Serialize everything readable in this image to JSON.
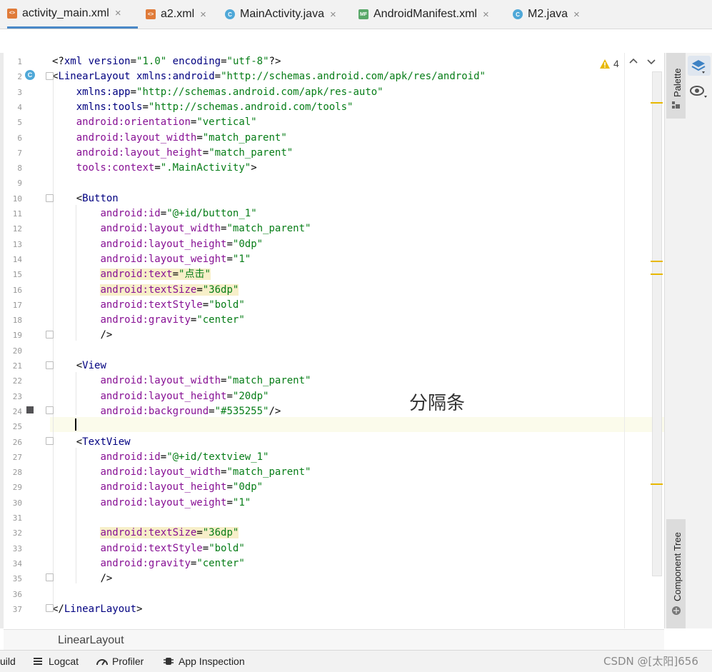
{
  "tabs": [
    {
      "label": "activity_main.xml",
      "icon": "xml-file-icon",
      "active": true
    },
    {
      "label": "a2.xml",
      "icon": "xml-file-icon",
      "active": false
    },
    {
      "label": "MainActivity.java",
      "icon": "java-class-icon",
      "active": false
    },
    {
      "label": "AndroidManifest.xml",
      "icon": "manifest-file-icon",
      "active": false
    },
    {
      "label": "M2.java",
      "icon": "java-class-icon",
      "active": false
    }
  ],
  "tab_close_glyph": "×",
  "icon_glyphs": {
    "xml": "<>",
    "java": "C",
    "mf": "MF"
  },
  "warnings": {
    "count": "4",
    "icon": "warning-icon"
  },
  "line_numbers": [
    "1",
    "2",
    "3",
    "4",
    "5",
    "6",
    "7",
    "8",
    "9",
    "10",
    "11",
    "12",
    "13",
    "14",
    "15",
    "16",
    "17",
    "18",
    "19",
    "20",
    "21",
    "22",
    "23",
    "24",
    "25",
    "26",
    "27",
    "28",
    "29",
    "30",
    "31",
    "32",
    "33",
    "34",
    "35",
    "36",
    "37"
  ],
  "code_lines": [
    "<?xml version=\"1.0\" encoding=\"utf-8\"?>",
    "<LinearLayout xmlns:android=\"http://schemas.android.com/apk/res/android\"",
    "    xmlns:app=\"http://schemas.android.com/apk/res-auto\"",
    "    xmlns:tools=\"http://schemas.android.com/tools\"",
    "    android:orientation=\"vertical\"",
    "    android:layout_width=\"match_parent\"",
    "    android:layout_height=\"match_parent\"",
    "    tools:context=\".MainActivity\">",
    "",
    "    <Button",
    "        android:id=\"@+id/button_1\"",
    "        android:layout_width=\"match_parent\"",
    "        android:layout_height=\"0dp\"",
    "        android:layout_weight=\"1\"",
    "        android:text=\"点击\"",
    "        android:textSize=\"36dp\"",
    "        android:textStyle=\"bold\"",
    "        android:gravity=\"center\"",
    "        />",
    "",
    "    <View",
    "        android:layout_width=\"match_parent\"",
    "        android:layout_height=\"20dp\"",
    "        android:background=\"#535255\"/>",
    "",
    "    <TextView",
    "        android:id=\"@+id/textview_1\"",
    "        android:layout_width=\"match_parent\"",
    "        android:layout_height=\"0dp\"",
    "        android:layout_weight=\"1\"",
    "",
    "        android:textSize=\"36dp\"",
    "        android:textStyle=\"bold\"",
    "        android:gravity=\"center\"",
    "        />",
    "",
    "</LinearLayout>"
  ],
  "annotation": "分隔条",
  "right_panel": {
    "palette": "Palette",
    "component_tree": "Component Tree"
  },
  "breadcrumb": "LinearLayout",
  "bottom_tools": [
    {
      "label": "uild",
      "icon": ""
    },
    {
      "label": "Logcat",
      "icon": "logcat-icon"
    },
    {
      "label": "Profiler",
      "icon": "profiler-icon"
    },
    {
      "label": "App Inspection",
      "icon": "app-inspection-icon"
    }
  ],
  "watermark": "CSDN @[太阳]656",
  "colors": {
    "tag": "#000080",
    "attribute": "#871094",
    "value": "#067d17",
    "highlight": "#f7efc9",
    "active_tab": "#4a88c7",
    "warning_marker": "#e8b800"
  }
}
